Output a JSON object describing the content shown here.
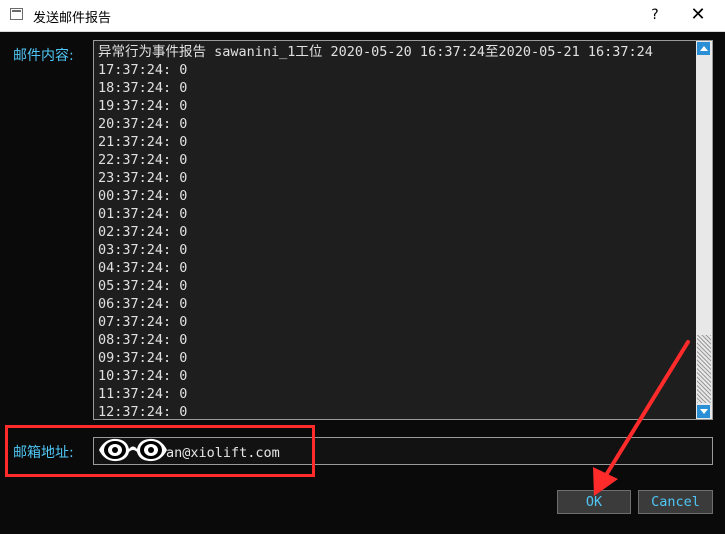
{
  "window": {
    "title": "发送邮件报告",
    "help": "?",
    "close": "✕"
  },
  "labels": {
    "content": "邮件内容:",
    "email": "邮箱地址:"
  },
  "content_lines": [
    "异常行为事件报告 sawanini_1工位 2020-05-20 16:37:24至2020-05-21 16:37:24",
    "17:37:24: 0",
    "18:37:24: 0",
    "19:37:24: 0",
    "20:37:24: 0",
    "21:37:24: 0",
    "22:37:24: 0",
    "23:37:24: 0",
    "00:37:24: 0",
    "01:37:24: 0",
    "02:37:24: 0",
    "03:37:24: 0",
    "04:37:24: 0",
    "05:37:24: 0",
    "06:37:24: 0",
    "07:37:24: 0",
    "08:37:24: 0",
    "09:37:24: 0",
    "10:37:24: 0",
    "11:37:24: 0",
    "12:37:24: 0"
  ],
  "email_value": "an@xiolift.com",
  "buttons": {
    "ok": "OK",
    "cancel": "Cancel"
  },
  "colors": {
    "accent": "#4fc6f5",
    "highlight": "#ff2b2b"
  }
}
